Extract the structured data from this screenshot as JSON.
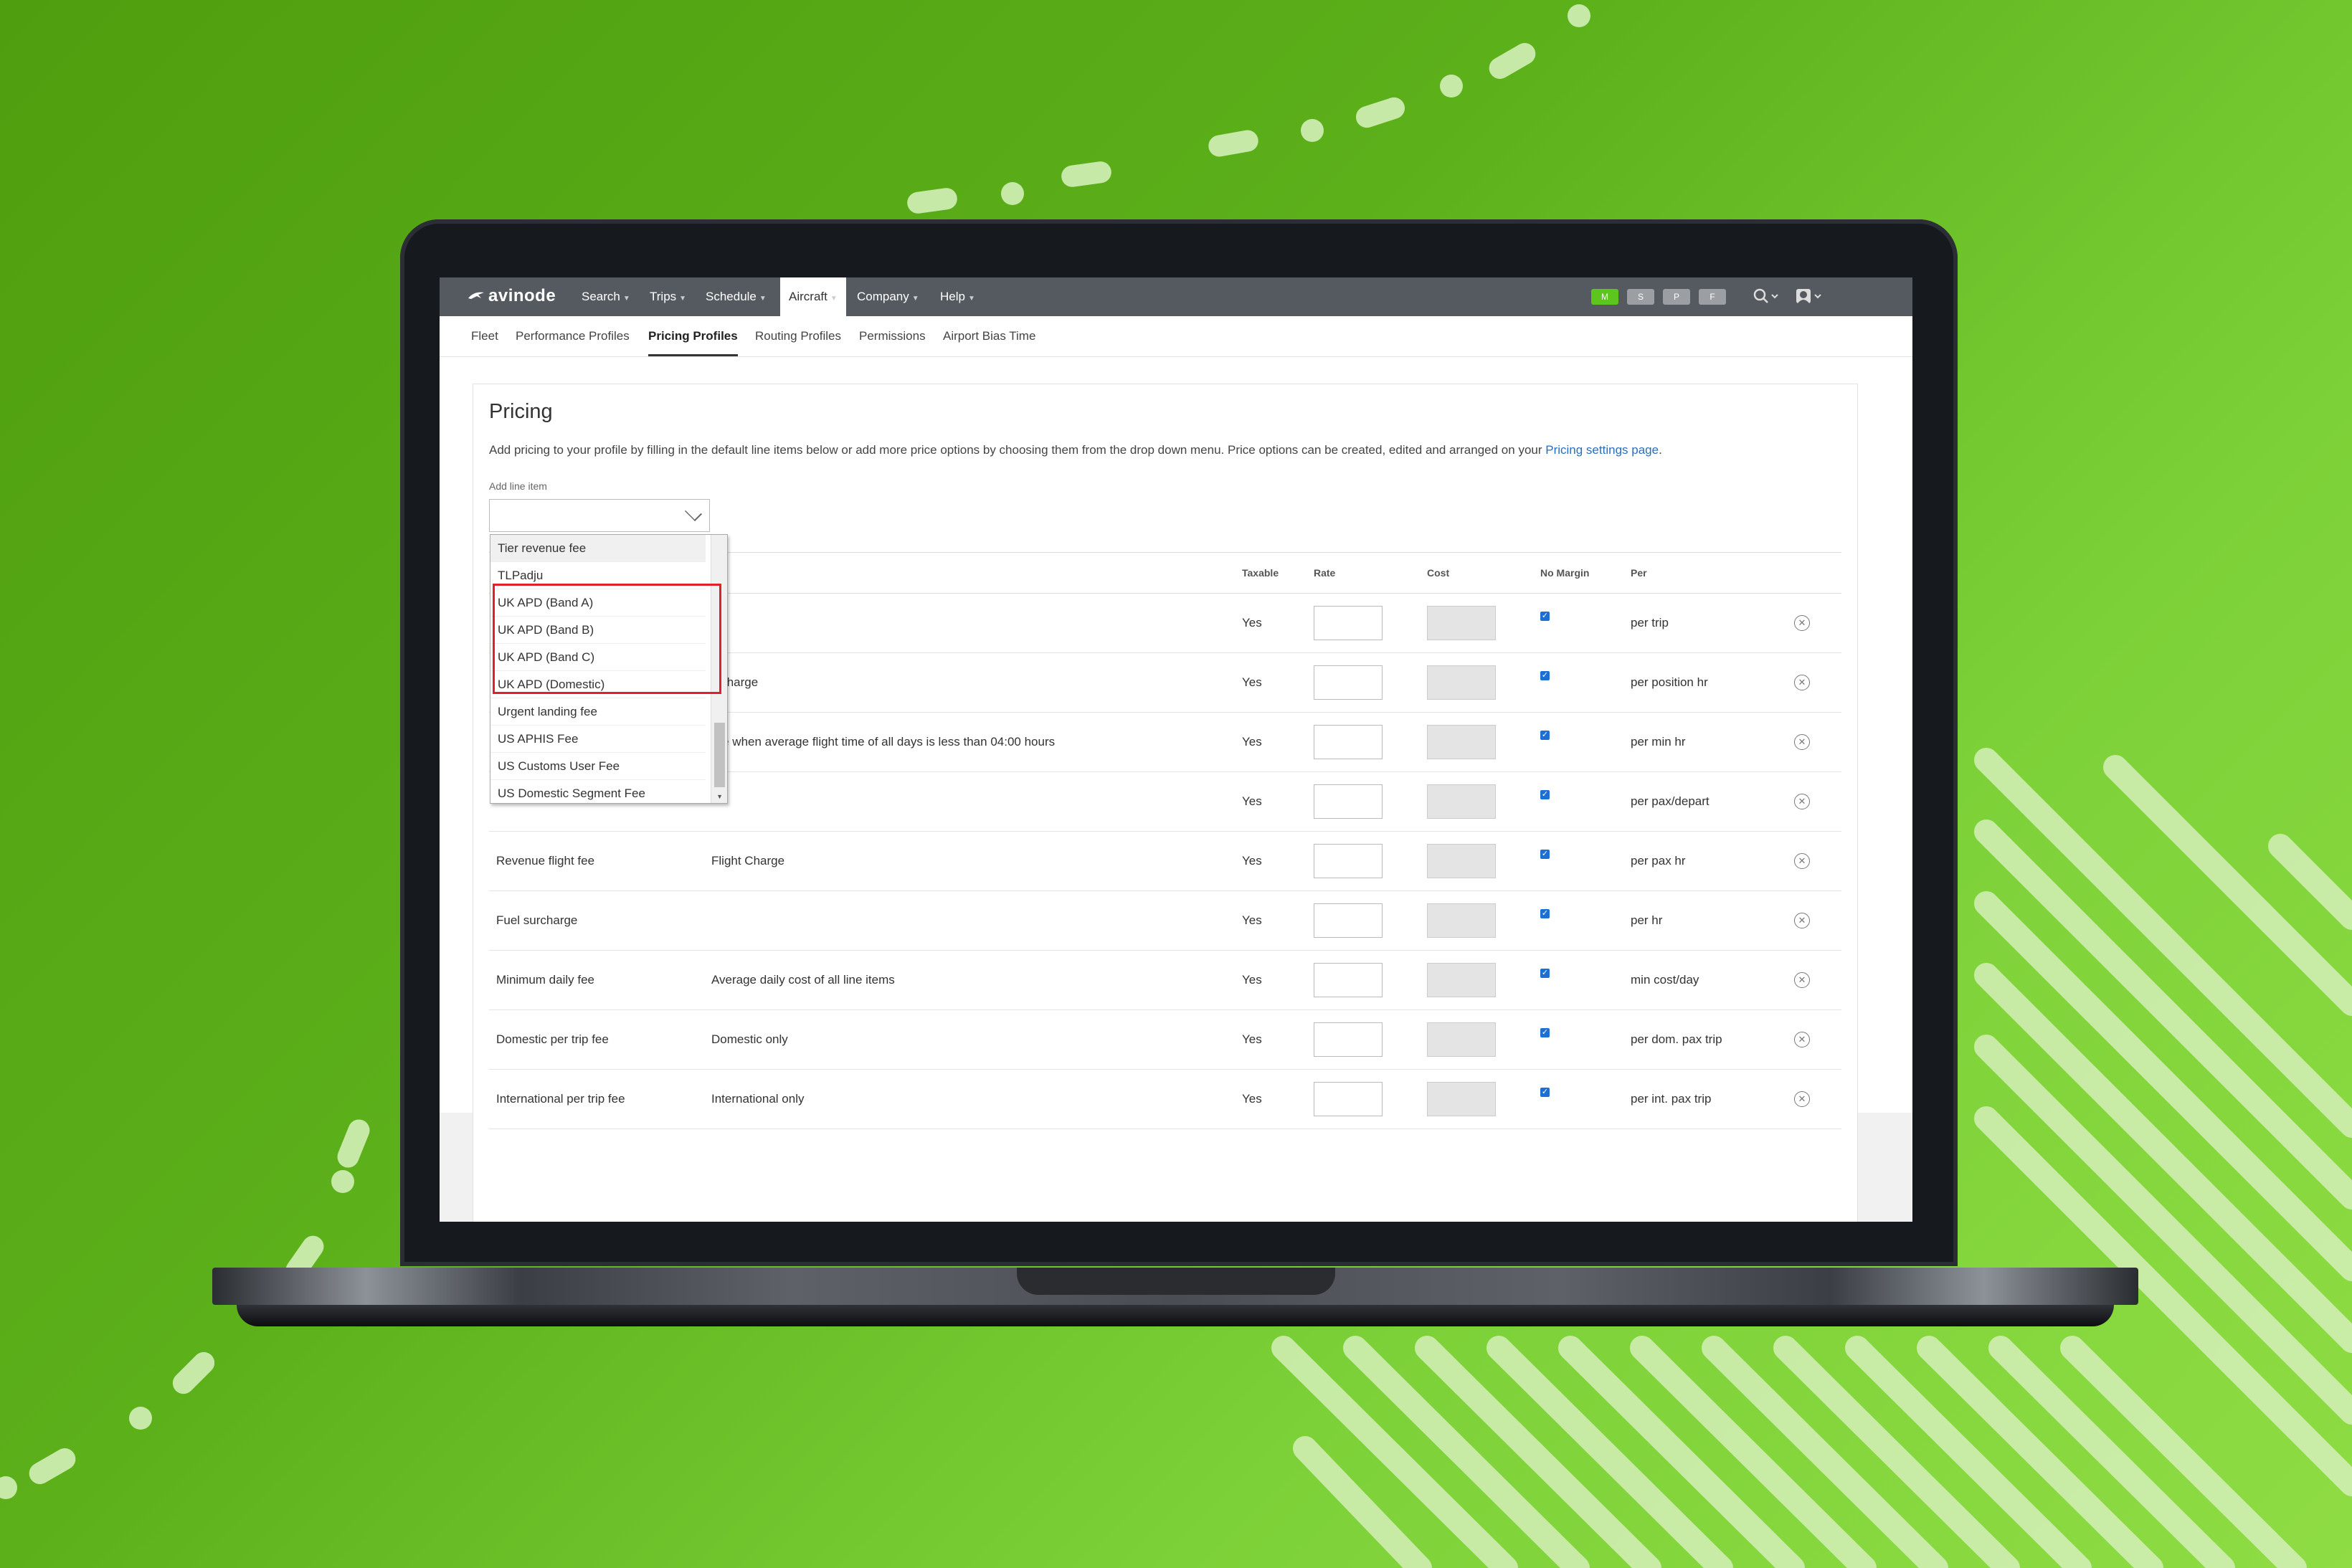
{
  "colors": {
    "accent_green": "#5cc61e",
    "nav_bg": "#555a60",
    "link_blue": "#2a6ebd",
    "highlight_red": "#e0202a",
    "checkbox_blue": "#1e6fd4"
  },
  "app": {
    "logo_text": "avinode",
    "logo_icon": "plane-swoosh-icon"
  },
  "topnav": {
    "items": [
      {
        "label": "Search",
        "icon": "caret-down-icon"
      },
      {
        "label": "Trips",
        "icon": "caret-down-icon"
      },
      {
        "label": "Schedule",
        "icon": "caret-down-icon"
      },
      {
        "label": "Aircraft",
        "icon": "caret-down-icon",
        "active": true
      },
      {
        "label": "Company",
        "icon": "caret-down-icon"
      },
      {
        "label": "Help",
        "icon": "caret-down-icon"
      }
    ],
    "status_pills": [
      {
        "label": "M",
        "active": true
      },
      {
        "label": "S"
      },
      {
        "label": "P"
      },
      {
        "label": "F"
      }
    ],
    "search_icon": "search-icon",
    "user_icon": "user-icon"
  },
  "subnav": {
    "items": [
      {
        "label": "Fleet"
      },
      {
        "label": "Performance Profiles"
      },
      {
        "label": "Pricing Profiles",
        "active": true
      },
      {
        "label": "Routing Profiles"
      },
      {
        "label": "Permissions"
      },
      {
        "label": "Airport Bias Time"
      }
    ]
  },
  "pricing": {
    "title": "Pricing",
    "description": "Add pricing to your profile by filling in the default line items below or add more price options by choosing them from the drop down menu. Price options can be created, edited and arranged on your",
    "link_text": "Pricing settings page",
    "add_line_label": "Add line item",
    "select_value": "",
    "dropdown_options": [
      "Tier revenue fee",
      "TLPadju",
      "UK APD (Band A)",
      "UK APD (Band B)",
      "UK APD (Band C)",
      "UK APD (Domestic)",
      "Urgent landing fee",
      "US APHIS Fee",
      "US Customs User Fee",
      "US Domestic Segment Fee"
    ],
    "columns": {
      "details": "ils",
      "taxable": "Taxable",
      "rate": "Rate",
      "cost": "Cost",
      "no_margin": "No Margin",
      "per": "Per"
    },
    "rows": [
      {
        "name": "",
        "details": "",
        "taxable": "Yes",
        "no_margin": true,
        "per": "per trip"
      },
      {
        "name": "",
        "details": "t Charge",
        "taxable": "Yes",
        "no_margin": true,
        "per": "per position hr"
      },
      {
        "name": "",
        "details": "rge when average flight time of all days is less than 04:00 hours",
        "taxable": "Yes",
        "no_margin": true,
        "per": "per min hr"
      },
      {
        "name": "",
        "details": "",
        "taxable": "Yes",
        "no_margin": true,
        "per": "per pax/depart"
      },
      {
        "name": "Revenue flight fee",
        "details": "Flight Charge",
        "taxable": "Yes",
        "no_margin": true,
        "per": "per pax hr"
      },
      {
        "name": "Fuel surcharge",
        "details": "",
        "taxable": "Yes",
        "no_margin": true,
        "per": "per hr"
      },
      {
        "name": "Minimum daily fee",
        "details": "Average daily cost of all line items",
        "taxable": "Yes",
        "no_margin": true,
        "per": "min cost/day"
      },
      {
        "name": "Domestic per trip fee",
        "details": "Domestic only",
        "taxable": "Yes",
        "no_margin": true,
        "per": "per dom. pax trip"
      },
      {
        "name": "International per trip fee",
        "details": "International only",
        "taxable": "Yes",
        "no_margin": true,
        "per": "per int. pax trip"
      }
    ]
  }
}
